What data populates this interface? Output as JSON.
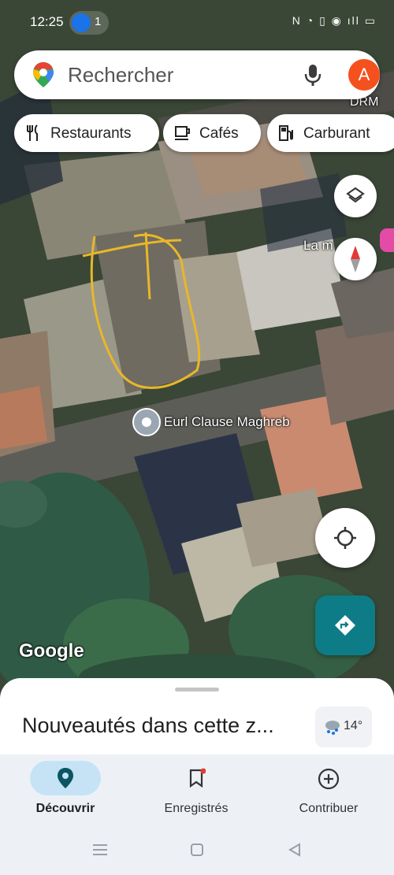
{
  "status_bar": {
    "time": "12:25",
    "notification_count": "1",
    "icons_text": "N ◔ ▯ ◉ ıll ▭"
  },
  "search": {
    "placeholder": "Rechercher",
    "avatar_letter": "A"
  },
  "chips": [
    {
      "label": "Restaurants",
      "icon": "fork-knife-icon"
    },
    {
      "label": "Cafés",
      "icon": "coffee-cup-icon"
    },
    {
      "label": "Carburant",
      "icon": "gas-pump-icon"
    }
  ],
  "map": {
    "poi_label": "Eurl Clause Maghreb",
    "place_label": "La m",
    "drm_label": "DRM",
    "logo": "Google"
  },
  "bottom_sheet": {
    "title": "Nouveautés dans cette z...",
    "temperature": "14°"
  },
  "nav": {
    "items": [
      {
        "label": "Découvrir",
        "icon": "location-pin-icon",
        "active": true
      },
      {
        "label": "Enregistrés",
        "icon": "bookmark-icon",
        "active": false
      },
      {
        "label": "Contribuer",
        "icon": "plus-circle-icon",
        "active": false
      }
    ]
  },
  "colors": {
    "accent_blue": "#1a73e8",
    "avatar_orange": "#f4511e",
    "directions_teal": "#0e7c86",
    "drawing_yellow": "#e8b72a"
  }
}
